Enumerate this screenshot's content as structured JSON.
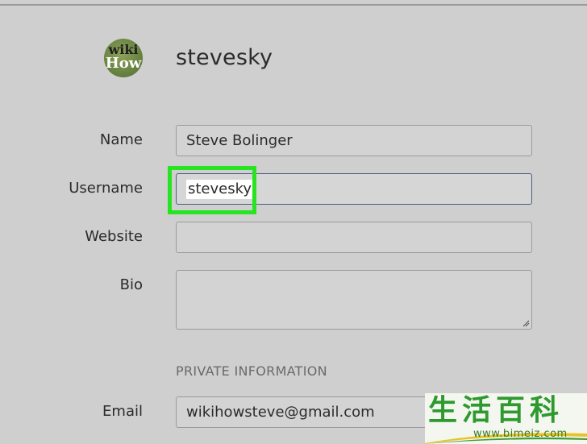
{
  "profile": {
    "avatar_text_top": "wiki",
    "avatar_text_bottom": "How",
    "handle": "stevesky"
  },
  "form": {
    "name_label": "Name",
    "name_value": "Steve Bolinger",
    "username_label": "Username",
    "username_value": "stevesky",
    "website_label": "Website",
    "website_value": "",
    "bio_label": "Bio",
    "bio_value": "",
    "private_section_heading": "PRIVATE INFORMATION",
    "email_label": "Email",
    "email_value": "wikihowsteve@gmail.com"
  },
  "colors": {
    "highlight": "#27e421",
    "focus_border": "#4a5f82",
    "background": "#cfcfcf"
  },
  "watermark": {
    "chinese": "生活百科",
    "url": "www.bimeiz.com"
  }
}
